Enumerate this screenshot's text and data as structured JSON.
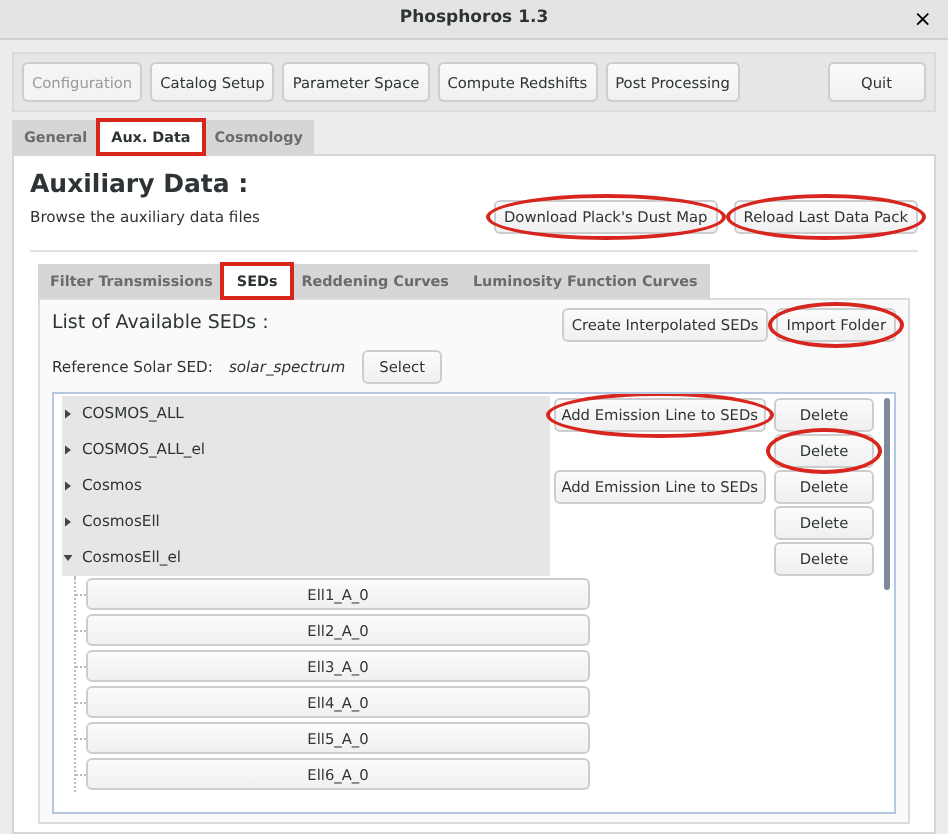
{
  "window": {
    "title": "Phosphoros 1.3",
    "close": "×"
  },
  "toolbar": [
    {
      "label": "Configuration",
      "disabled": true
    },
    {
      "label": "Catalog Setup",
      "disabled": false
    },
    {
      "label": "Parameter Space",
      "disabled": false
    },
    {
      "label": "Compute Redshifts",
      "disabled": false
    },
    {
      "label": "Post Processing",
      "disabled": false
    }
  ],
  "quit": "Quit",
  "main_tabs": [
    {
      "label": "General",
      "selected": false
    },
    {
      "label": "Aux. Data",
      "selected": true,
      "boxed": true
    },
    {
      "label": "Cosmology",
      "selected": false
    }
  ],
  "heading": "Auxiliary Data :",
  "subtitle": "Browse the auxiliary data files",
  "top_actions": [
    {
      "label": "Download Plack's Dust Map",
      "circled": true
    },
    {
      "label": "Reload Last Data Pack",
      "circled": true
    }
  ],
  "sub_tabs": [
    {
      "label": "Filter Transmissions",
      "selected": false
    },
    {
      "label": "SEDs",
      "selected": true,
      "boxed": true
    },
    {
      "label": "Reddening Curves",
      "selected": false
    },
    {
      "label": "Luminosity Function Curves",
      "selected": false
    }
  ],
  "sed_panel": {
    "title": "List of Available SEDs :",
    "actions": [
      {
        "label": "Create Interpolated SEDs"
      },
      {
        "label": "Import Folder",
        "circled": true
      }
    ],
    "reference_label": "Reference Solar SED:",
    "reference_value": "solar_spectrum",
    "select_button": "Select",
    "tree": [
      {
        "name": "COSMOS_ALL",
        "expanded": false,
        "emission_button": "Add Emission Line to SEDs",
        "emission_circled": true,
        "delete_button": "Delete"
      },
      {
        "name": "COSMOS_ALL_el",
        "expanded": false,
        "delete_button": "Delete",
        "delete_circled": true
      },
      {
        "name": "Cosmos",
        "expanded": false,
        "emission_button": "Add Emission Line to SEDs",
        "delete_button": "Delete"
      },
      {
        "name": "CosmosEll",
        "expanded": false,
        "delete_button": "Delete"
      },
      {
        "name": "CosmosEll_el",
        "expanded": true,
        "delete_button": "Delete",
        "children": [
          {
            "name": "Ell1_A_0"
          },
          {
            "name": "Ell2_A_0"
          },
          {
            "name": "Ell3_A_0"
          },
          {
            "name": "Ell4_A_0"
          },
          {
            "name": "Ell5_A_0"
          },
          {
            "name": "Ell6_A_0"
          }
        ]
      }
    ]
  }
}
